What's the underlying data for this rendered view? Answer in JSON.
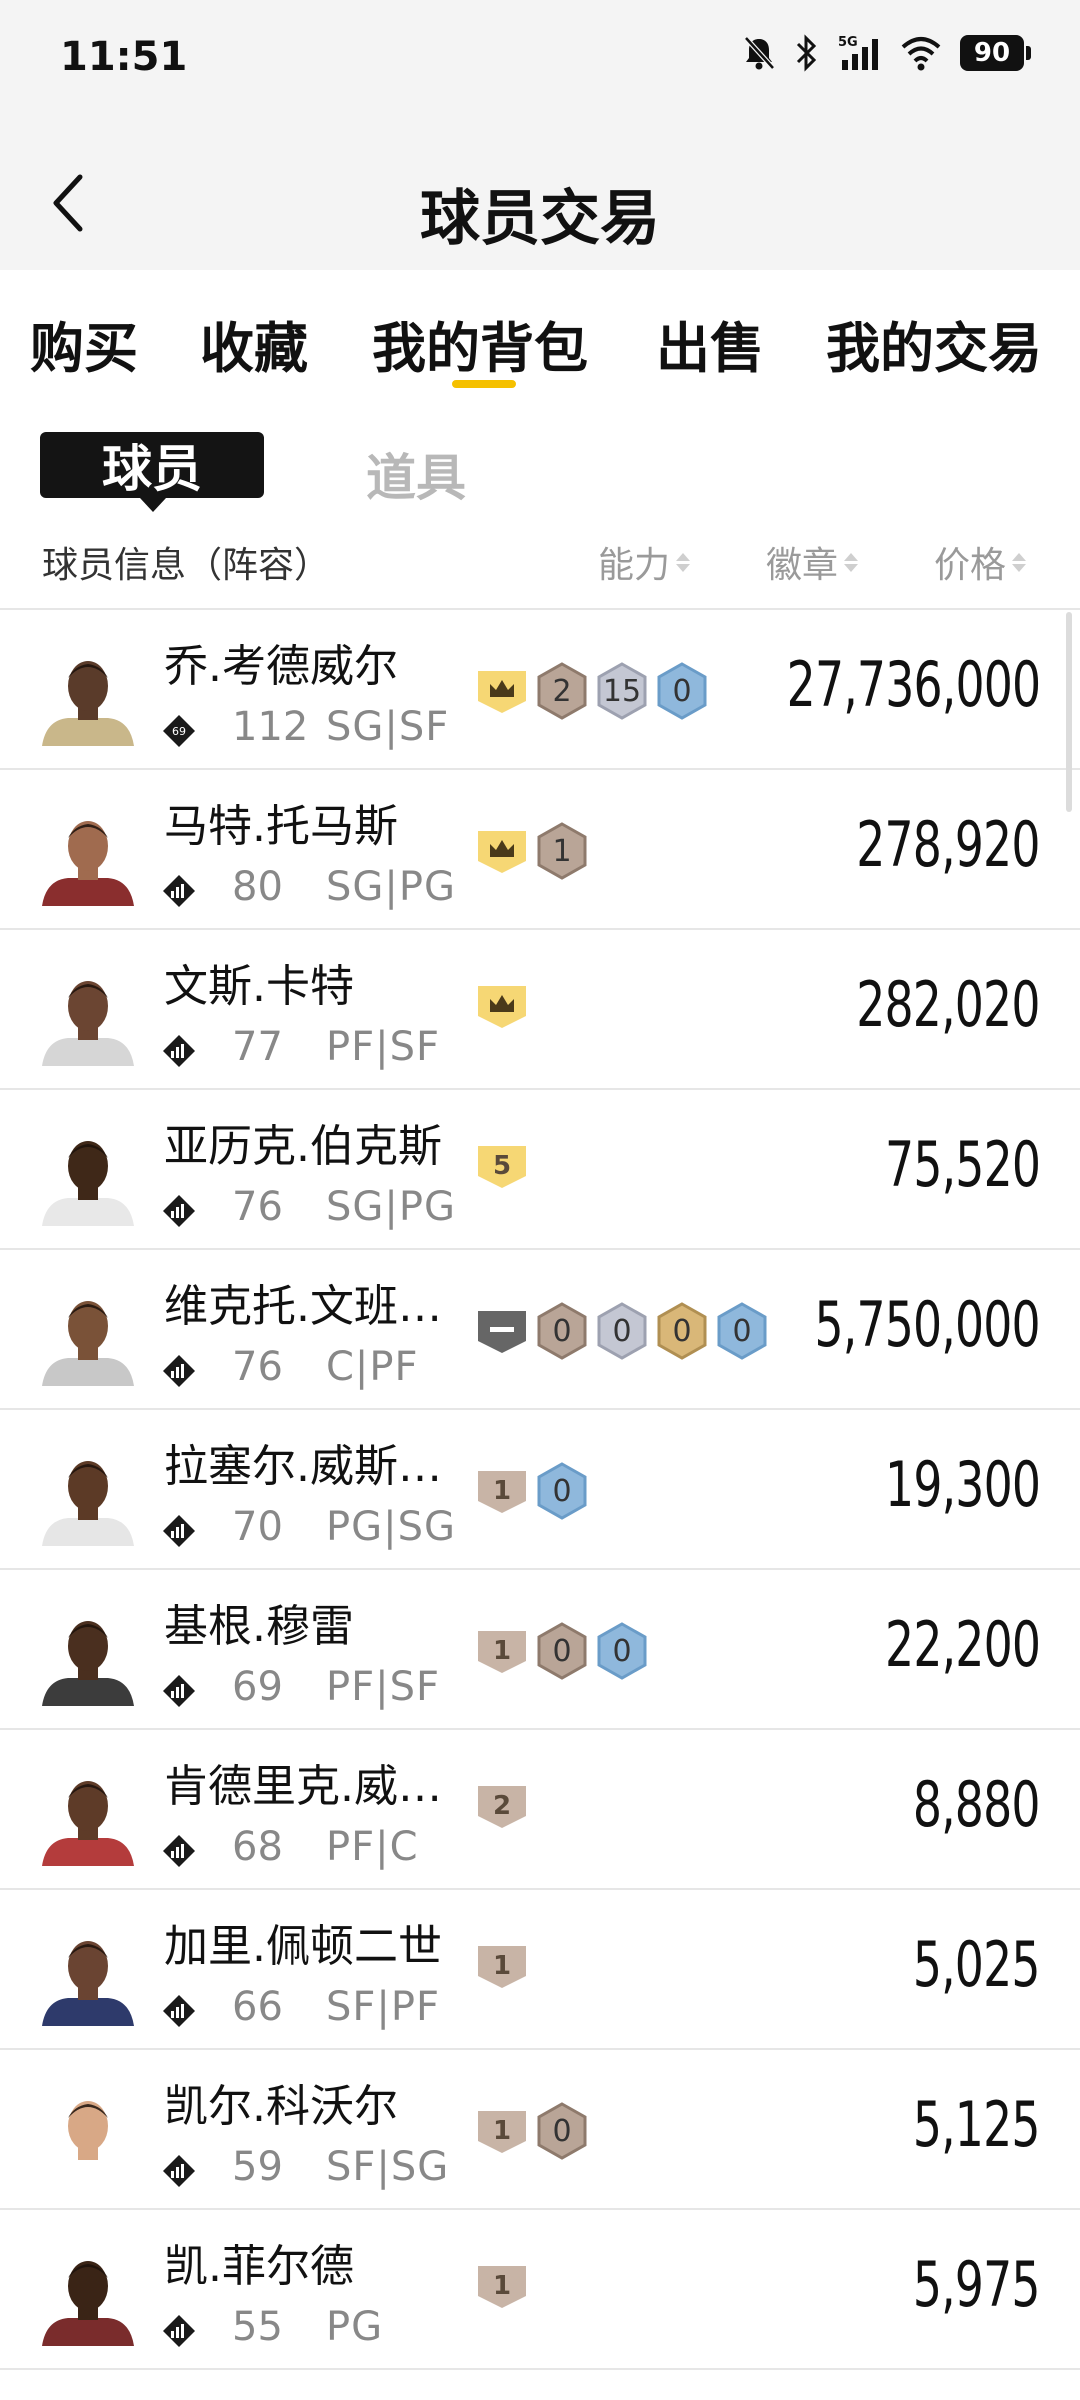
{
  "status_bar": {
    "time": "11:51",
    "battery": "90",
    "network": "5G"
  },
  "header": {
    "title": "球员交易"
  },
  "main_tabs": [
    {
      "label": "购买"
    },
    {
      "label": "收藏"
    },
    {
      "label": "我的背包",
      "active": true
    },
    {
      "label": "出售"
    },
    {
      "label": "我的交易"
    }
  ],
  "sub_tabs": [
    {
      "label": "球员",
      "active": true
    },
    {
      "label": "道具"
    }
  ],
  "columns": {
    "info": "球员信息（阵容）",
    "ability": "能力",
    "badge": "徽章",
    "price": "价格"
  },
  "colors": {
    "accent": "#f5c000",
    "gold_tag": "#f6d774",
    "bronze_tag": "#c8b4a6",
    "gray_tag": "#666666"
  },
  "players": [
    {
      "name": "乔.考德威尔",
      "rating": "112",
      "rating_badge": "69",
      "pos": "SG|SF",
      "price": "27,736,000",
      "tag": {
        "type": "crown",
        "color": "gold"
      },
      "badges": [
        {
          "value": "2",
          "color": "bronze"
        },
        {
          "value": "15",
          "color": "silver"
        },
        {
          "value": "0",
          "color": "blue"
        }
      ]
    },
    {
      "name": "马特.托马斯",
      "rating": "80",
      "pos": "SG|PG",
      "price": "278,920",
      "tag": {
        "type": "crown",
        "color": "gold"
      },
      "badges": [
        {
          "value": "1",
          "color": "bronze"
        }
      ]
    },
    {
      "name": "文斯.卡特",
      "rating": "77",
      "pos": "PF|SF",
      "price": "282,020",
      "tag": {
        "type": "crown",
        "color": "gold"
      },
      "badges": []
    },
    {
      "name": "亚历克.伯克斯",
      "rating": "76",
      "pos": "SG|PG",
      "price": "75,520",
      "tag": {
        "type": "number",
        "value": "5",
        "color": "gold"
      },
      "badges": []
    },
    {
      "name": "维克托.文班…",
      "rating": "76",
      "pos": "C|PF",
      "price": "5,750,000",
      "tag": {
        "type": "dash",
        "color": "gray"
      },
      "badges": [
        {
          "value": "0",
          "color": "bronze"
        },
        {
          "value": "0",
          "color": "silver"
        },
        {
          "value": "0",
          "color": "gold"
        },
        {
          "value": "0",
          "color": "blue"
        }
      ]
    },
    {
      "name": "拉塞尔.威斯…",
      "rating": "70",
      "pos": "PG|SG",
      "price": "19,300",
      "tag": {
        "type": "number",
        "value": "1",
        "color": "bronze"
      },
      "badges": [
        {
          "value": "0",
          "color": "blue"
        }
      ]
    },
    {
      "name": "基根.穆雷",
      "rating": "69",
      "pos": "PF|SF",
      "price": "22,200",
      "tag": {
        "type": "number",
        "value": "1",
        "color": "bronze"
      },
      "badges": [
        {
          "value": "0",
          "color": "bronze"
        },
        {
          "value": "0",
          "color": "blue"
        }
      ]
    },
    {
      "name": "肯德里克.威…",
      "rating": "68",
      "pos": "PF|C",
      "price": "8,880",
      "tag": {
        "type": "number",
        "value": "2",
        "color": "bronze"
      },
      "badges": []
    },
    {
      "name": "加里.佩顿二世",
      "rating": "66",
      "pos": "SF|PF",
      "price": "5,025",
      "tag": {
        "type": "number",
        "value": "1",
        "color": "bronze"
      },
      "badges": []
    },
    {
      "name": "凯尔.科沃尔",
      "rating": "59",
      "pos": "SF|SG",
      "price": "5,125",
      "tag": {
        "type": "number",
        "value": "1",
        "color": "bronze"
      },
      "badges": [
        {
          "value": "0",
          "color": "bronze"
        }
      ]
    },
    {
      "name": "凯.菲尔德",
      "rating": "55",
      "pos": "PG",
      "price": "5,975",
      "tag": {
        "type": "number",
        "value": "1",
        "color": "bronze"
      },
      "badges": []
    }
  ]
}
